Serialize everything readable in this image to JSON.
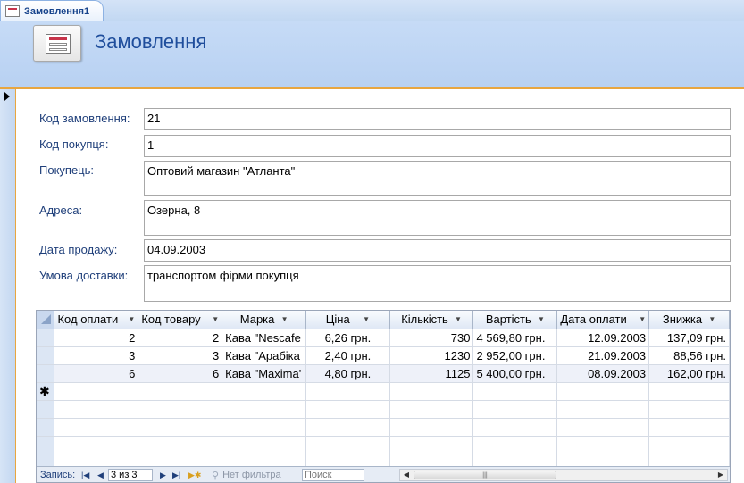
{
  "tab": {
    "title": "Замовлення1",
    "icon": "form-icon"
  },
  "header": {
    "title": "Замовлення",
    "logo_icon": "form-logo-icon"
  },
  "fields": {
    "order_code": {
      "label": "Код замовлення:",
      "value": "21"
    },
    "customer_code": {
      "label": "Код покупця:",
      "value": "1"
    },
    "customer": {
      "label": "Покупець:",
      "value": "Оптовий магазин \"Атланта\""
    },
    "address": {
      "label": "Адреса:",
      "value": "Озерна, 8"
    },
    "sale_date": {
      "label": "Дата продажу:",
      "value": "04.09.2003"
    },
    "delivery": {
      "label": "Умова доставки:",
      "value": "транспортом фірми покупця"
    }
  },
  "grid": {
    "columns": [
      "Код оплати",
      "Код товару",
      "Марка",
      "Ціна",
      "Кількість",
      "Вартість",
      "Дата оплати",
      "Знижка"
    ],
    "rows": [
      [
        "2",
        "2",
        "Кава \"Nescafe",
        "6,26 грн.",
        "730",
        "4 569,80 грн.",
        "12.09.2003",
        "137,09 грн."
      ],
      [
        "3",
        "3",
        "Кава \"Арабіка",
        "2,40 грн.",
        "1230",
        "2 952,00 грн.",
        "21.09.2003",
        "88,56 грн."
      ],
      [
        "6",
        "6",
        "Кава \"Maxima'",
        "4,80 грн.",
        "1125",
        "5 400,00 грн.",
        "08.09.2003",
        "162,00 грн."
      ]
    ],
    "new_row_symbol": "✱"
  },
  "navigation": {
    "record_label": "Запись:",
    "position": "3 из 3",
    "filter_label": "Нет фильтра",
    "search_placeholder": "Поиск"
  }
}
